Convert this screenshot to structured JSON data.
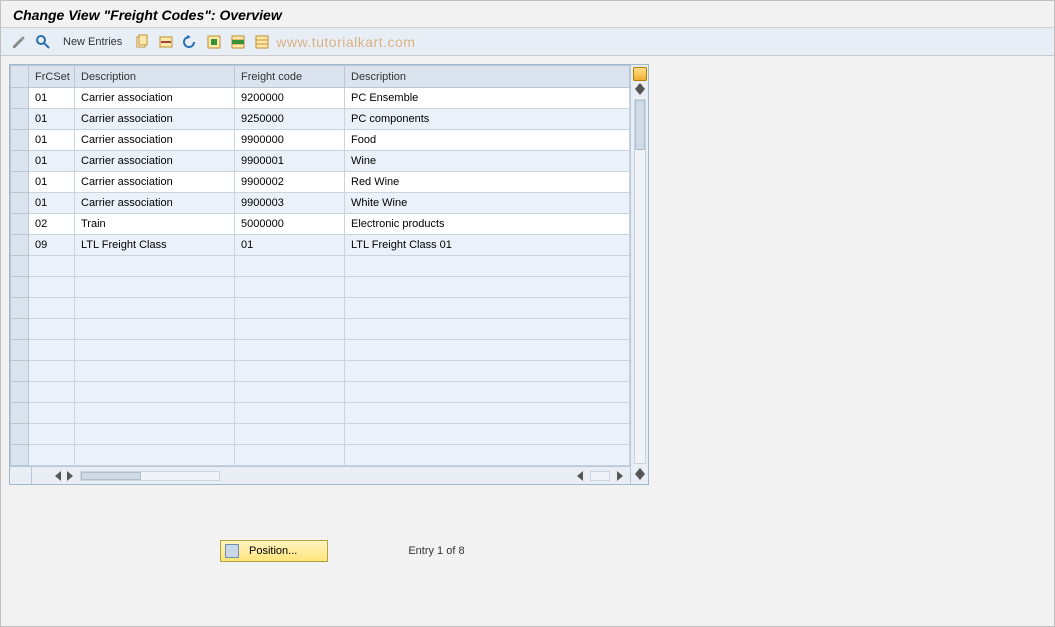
{
  "title": "Change View \"Freight Codes\": Overview",
  "toolbar": {
    "new_entries_label": "New Entries"
  },
  "watermark": "www.tutorialkart.com",
  "table": {
    "headers": {
      "frcset": "FrCSet",
      "desc1": "Description",
      "fcode": "Freight code",
      "desc2": "Description"
    },
    "rows": [
      {
        "frcset": "01",
        "desc1": "Carrier association",
        "fcode": "9200000",
        "desc2": "PC Ensemble"
      },
      {
        "frcset": "01",
        "desc1": "Carrier association",
        "fcode": "9250000",
        "desc2": "PC components"
      },
      {
        "frcset": "01",
        "desc1": "Carrier association",
        "fcode": "9900000",
        "desc2": "Food"
      },
      {
        "frcset": "01",
        "desc1": "Carrier association",
        "fcode": "9900001",
        "desc2": "Wine"
      },
      {
        "frcset": "01",
        "desc1": "Carrier association",
        "fcode": "9900002",
        "desc2": "Red Wine"
      },
      {
        "frcset": "01",
        "desc1": "Carrier association",
        "fcode": "9900003",
        "desc2": "White Wine"
      },
      {
        "frcset": "02",
        "desc1": "Train",
        "fcode": "5000000",
        "desc2": "Electronic products"
      },
      {
        "frcset": "09",
        "desc1": "LTL Freight Class",
        "fcode": "01",
        "desc2": "LTL Freight Class 01"
      }
    ],
    "empty_rows": 10
  },
  "footer": {
    "position_label": "Position...",
    "entry_text": "Entry 1 of 8"
  }
}
